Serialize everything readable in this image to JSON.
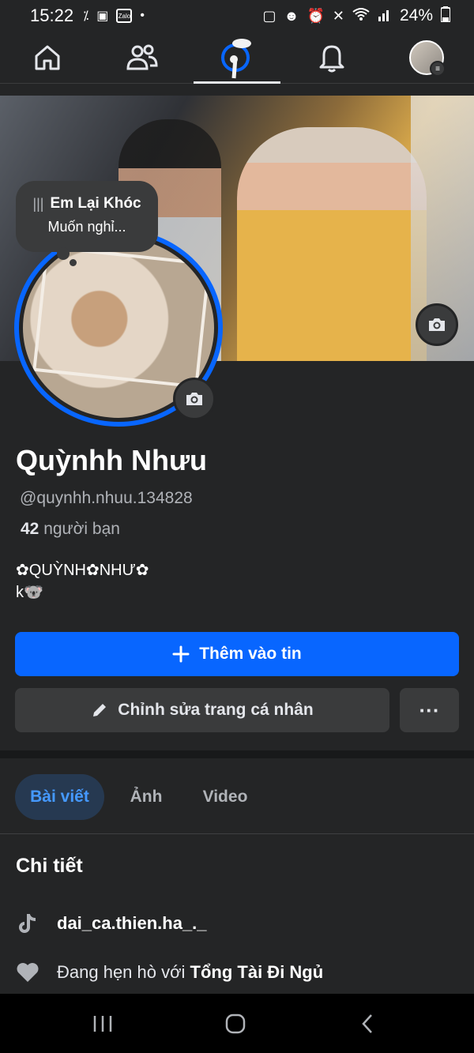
{
  "status_bar": {
    "time": "15:22",
    "battery": "24%",
    "left_icons": [
      "missed-call-icon",
      "image-icon",
      "zalo-icon",
      "dot-icon"
    ],
    "right_icons": [
      "app-icon",
      "pet-icon",
      "alarm-icon",
      "mute-icon",
      "wifi-icon",
      "signal-icon",
      "battery-icon"
    ],
    "zalo_label": "Zalo"
  },
  "nav": {
    "items": [
      {
        "name": "home",
        "icon": "home-icon"
      },
      {
        "name": "friends",
        "icon": "friends-icon"
      },
      {
        "name": "profile-sticker",
        "icon": "sticker-icon",
        "active": true
      },
      {
        "name": "notifications",
        "icon": "bell-icon"
      },
      {
        "name": "menu",
        "icon": "avatar-menu-icon"
      }
    ]
  },
  "note": {
    "song": "Em Lại Khóc",
    "text": "Muốn nghỉ..."
  },
  "profile": {
    "name": "Quỳnhh Nhưu",
    "username": "@quynhh.nhuu.134828",
    "friends_count": "42",
    "friends_label": "người bạn",
    "bio_line1": "✿QUỲNH✿NHƯ✿",
    "bio_line2": "k🐨"
  },
  "actions": {
    "add_story": "Thêm vào tin",
    "edit_profile": "Chỉnh sửa trang cá nhân",
    "more": "···"
  },
  "tabs": [
    {
      "label": "Bài viết",
      "active": true
    },
    {
      "label": "Ảnh",
      "active": false
    },
    {
      "label": "Video",
      "active": false
    }
  ],
  "details": {
    "title": "Chi tiết",
    "tiktok": "dai_ca.thien.ha_._",
    "relationship_prefix": "Đang hẹn hò với",
    "relationship_partner": "Tổng Tài Đi Ngủ"
  },
  "colors": {
    "accent": "#0866ff",
    "background": "#242526",
    "tab_active_bg": "#263951",
    "tab_active_text": "#4599ff"
  }
}
